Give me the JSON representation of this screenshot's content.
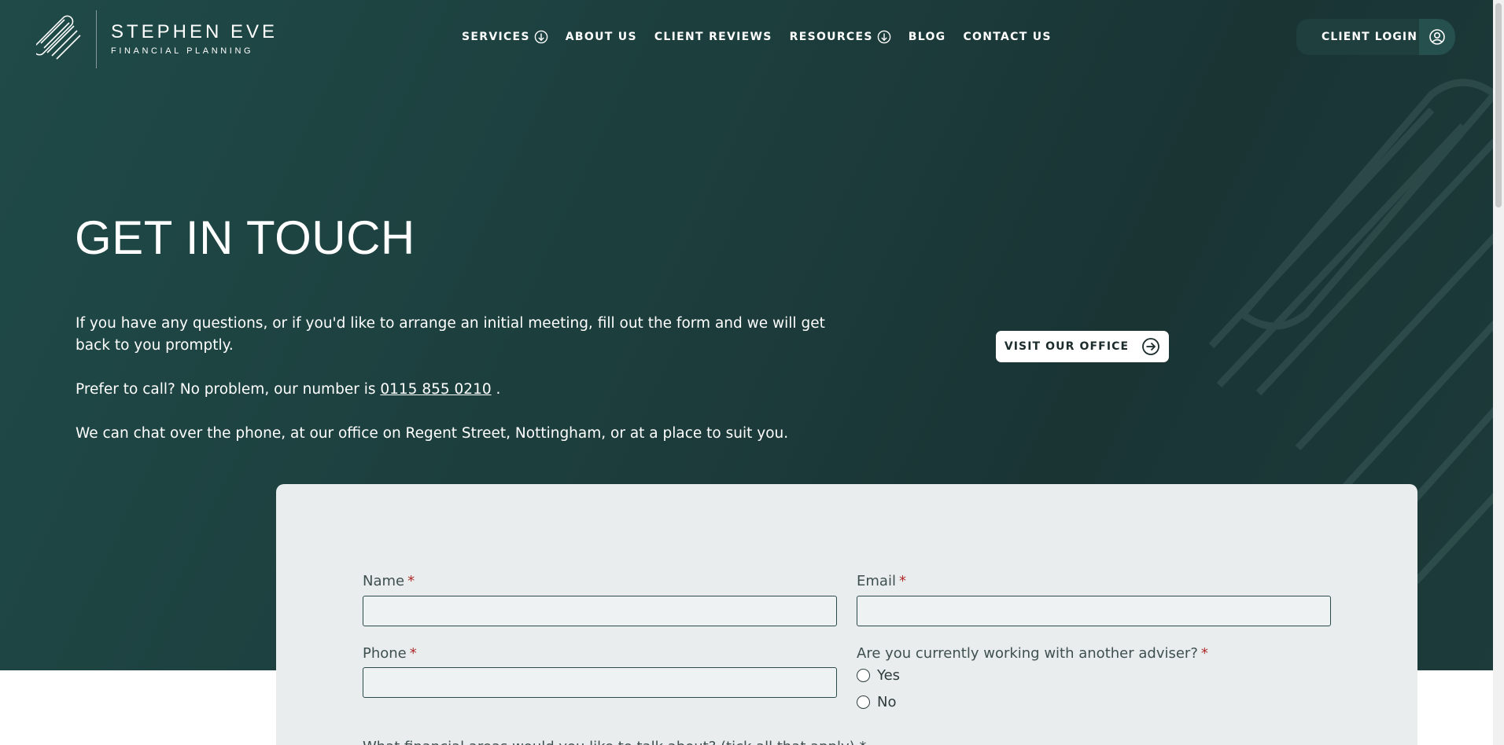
{
  "brand": {
    "name": "STEPHEN EVE",
    "tagline": "FINANCIAL PLANNING",
    "logo_icon": "diagonal-stripes-logo-icon"
  },
  "nav": {
    "items": [
      {
        "label": "SERVICES",
        "has_dropdown": true
      },
      {
        "label": "ABOUT US",
        "has_dropdown": false
      },
      {
        "label": "CLIENT REVIEWS",
        "has_dropdown": false
      },
      {
        "label": "RESOURCES",
        "has_dropdown": true
      },
      {
        "label": "BLOG",
        "has_dropdown": false
      },
      {
        "label": "CONTACT US",
        "has_dropdown": false
      }
    ],
    "dropdown_icon": "circle-arrow-down-icon"
  },
  "login": {
    "label": "CLIENT LOGIN",
    "icon": "user-circle-icon"
  },
  "hero": {
    "title": "GET IN TOUCH",
    "paragraph1": "If you have any questions, or if you'd like to arrange an initial meeting, fill out the form and we will get back to you promptly.",
    "paragraph2_prefix": "Prefer to call? No problem, our number is",
    "phone": "0115 855 0210",
    "paragraph2_suffix": ".",
    "paragraph3": "We can chat over the phone, at our office on Regent Street, Nottingham, or at a place to suit you.",
    "visit_button": "VISIT OUR OFFICE",
    "visit_icon": "circle-arrow-right-icon"
  },
  "form": {
    "name_label": "Name",
    "email_label": "Email",
    "phone_label": "Phone",
    "adviser_question": "Are you currently working with another adviser?",
    "required_marker": "*",
    "options": [
      "Yes",
      "No"
    ],
    "next_question_partial": "What financial areas would you like to talk about? (tick all that apply) *",
    "name_value": "",
    "email_value": "",
    "phone_value": ""
  },
  "colors": {
    "hero_bg": "#1c3d3c",
    "card_bg": "#e9eded",
    "required": "#b02a2a",
    "input_border": "#2b4b4a"
  }
}
